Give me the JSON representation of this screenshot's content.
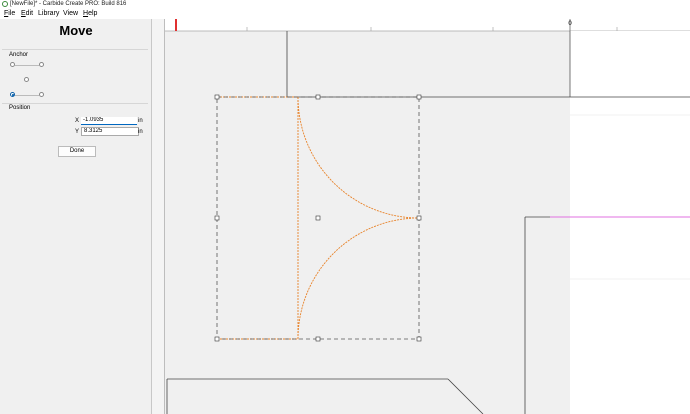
{
  "window": {
    "title": "[NewFile]* - Carbide Create PRO: Build 816"
  },
  "menu": [
    {
      "label": "File",
      "accel": "F",
      "rest": "ile"
    },
    {
      "label": "Edit",
      "accel": "E",
      "rest": "dit"
    },
    {
      "label": "Library",
      "accel": "",
      "rest": "Library"
    },
    {
      "label": "View",
      "accel": "",
      "rest": "View"
    },
    {
      "label": "Help",
      "accel": "H",
      "rest": "elp"
    }
  ],
  "panel": {
    "title": "Move",
    "anchor": {
      "label": "Anchor",
      "selected": "bottom-left",
      "options": [
        "top-left",
        "top-right",
        "center",
        "bottom-left",
        "bottom-right"
      ]
    },
    "position": {
      "label": "Position",
      "x_label": "X",
      "x_value": "-1.0935",
      "x_unit": "in",
      "y_label": "Y",
      "y_value": "8.3125",
      "y_unit": "in"
    },
    "done_label": "Done"
  },
  "canvas": {
    "ruler_marker": "0",
    "colors": {
      "background": "#f0f0f0",
      "stock": "#ffffff",
      "selection": "#555555",
      "curve": "#e8832a",
      "origin_marker": "#e03030",
      "axis_highlight": "#e070e0"
    }
  }
}
